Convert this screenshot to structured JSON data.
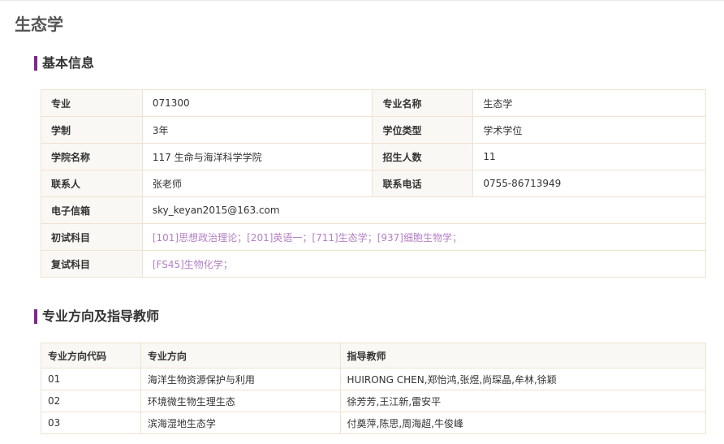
{
  "page_title": "生态学",
  "basic": {
    "heading": "基本信息",
    "major_code_label": "专业",
    "major_code": "071300",
    "major_name_label": "专业名称",
    "major_name": "生态学",
    "duration_label": "学制",
    "duration": "3年",
    "degree_type_label": "学位类型",
    "degree_type": "学术学位",
    "school_label": "学院名称",
    "school": "117 生命与海洋科学学院",
    "enrollment_label": "招生人数",
    "enrollment": "11",
    "contact_label": "联系人",
    "contact": "张老师",
    "phone_label": "联系电话",
    "phone": "0755-86713949",
    "email_label": "电子信箱",
    "email": "sky_keyan2015@163.com",
    "prelim_label": "初试科目",
    "prelim_subjects": [
      "[101]思想政治理论；",
      "[201]英语一；",
      "[711]生态学；",
      "[937]细胞生物学；"
    ],
    "retest_label": "复试科目",
    "retest_subjects": [
      "[FS45]生物化学；"
    ]
  },
  "directions": {
    "heading": "专业方向及指导教师",
    "headers": [
      "专业方向代码",
      "专业方向",
      "指导教师"
    ],
    "rows": [
      {
        "code": "01",
        "name": "海洋生物资源保护与利用",
        "advisors": "HUIRONG CHEN,郑怡鸿,张煜,尚琛晶,牟林,徐颖"
      },
      {
        "code": "02",
        "name": "环境微生物生理生态",
        "advisors": "徐芳芳,王江新,雷安平"
      },
      {
        "code": "03",
        "name": "滨海湿地生态学",
        "advisors": "付奠萍,陈思,周海超,牛俊峰"
      }
    ]
  }
}
